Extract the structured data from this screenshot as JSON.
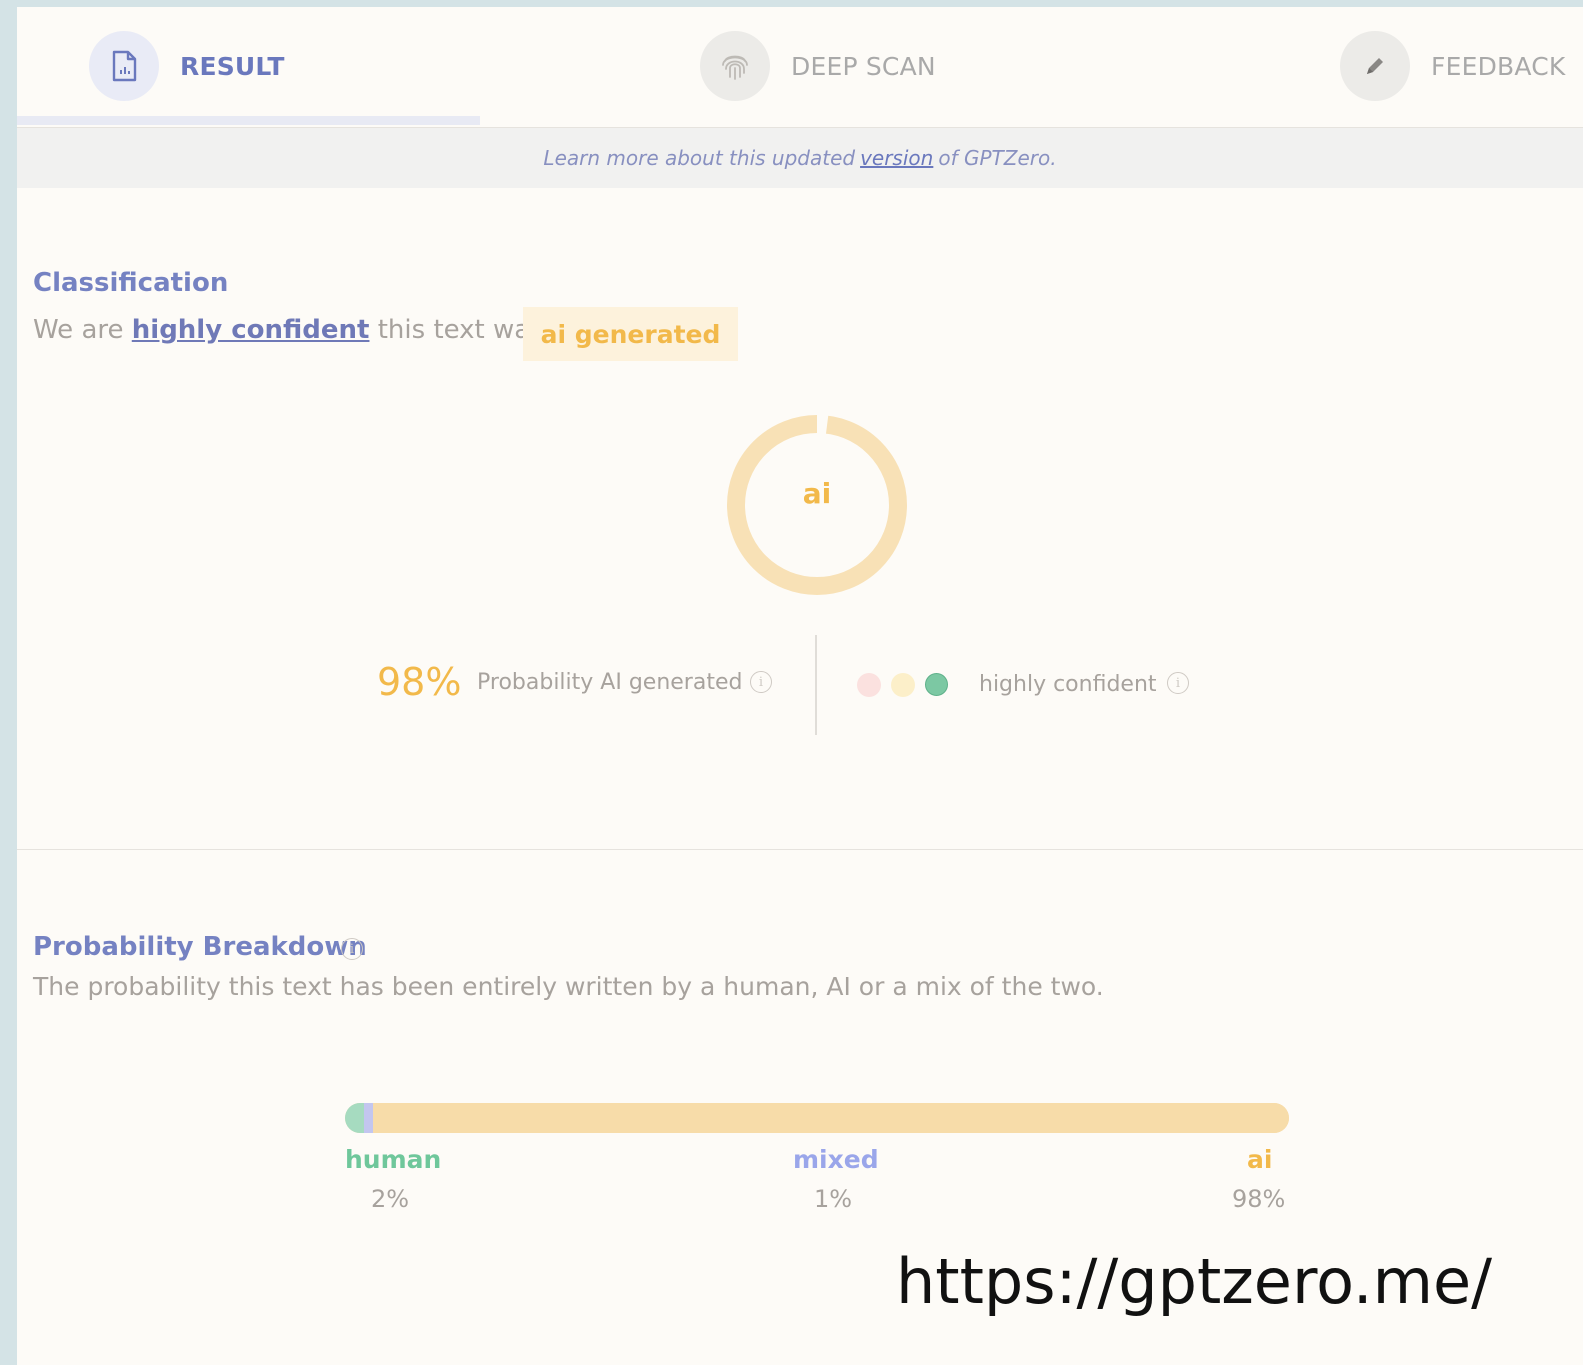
{
  "tabs": [
    {
      "label": "RESULT",
      "icon": "document-icon",
      "active": true
    },
    {
      "label": "DEEP SCAN",
      "icon": "fingerprint-icon",
      "active": false
    },
    {
      "label": "FEEDBACK",
      "icon": "pencil-icon",
      "active": false
    }
  ],
  "banner": {
    "prefix": "Learn more about this updated",
    "link": "version",
    "suffix": "of GPTZero."
  },
  "classification": {
    "title": "Classification",
    "sentence_prefix": "We are",
    "confidence_link": "highly confident",
    "sentence_suffix": "this text was",
    "badge": "ai generated",
    "donut_label": "ai",
    "probability_value": "98%",
    "probability_label": "Probability AI generated",
    "confidence_label": "highly confident",
    "donut_fraction": 0.98,
    "dots": [
      "#fbe1df",
      "#fcefc9",
      "#7cc8a3"
    ]
  },
  "breakdown": {
    "title": "Probability Breakdown",
    "description": "The probability this text has been entirely written by a human, AI or a mix of the two.",
    "items": [
      {
        "label": "human",
        "value": "2%",
        "fraction": 0.02,
        "color": "#6fc79b"
      },
      {
        "label": "mixed",
        "value": "1%",
        "fraction": 0.01,
        "color": "#9aa6ea"
      },
      {
        "label": "ai",
        "value": "98%",
        "fraction": 0.97,
        "color": "#f2b94a"
      }
    ]
  },
  "footer_url": "https://gptzero.me/",
  "colors": {
    "accent": "#6a78bd",
    "ai": "#f2b94a",
    "human": "#6fc79b",
    "mixed": "#9aa6ea"
  }
}
